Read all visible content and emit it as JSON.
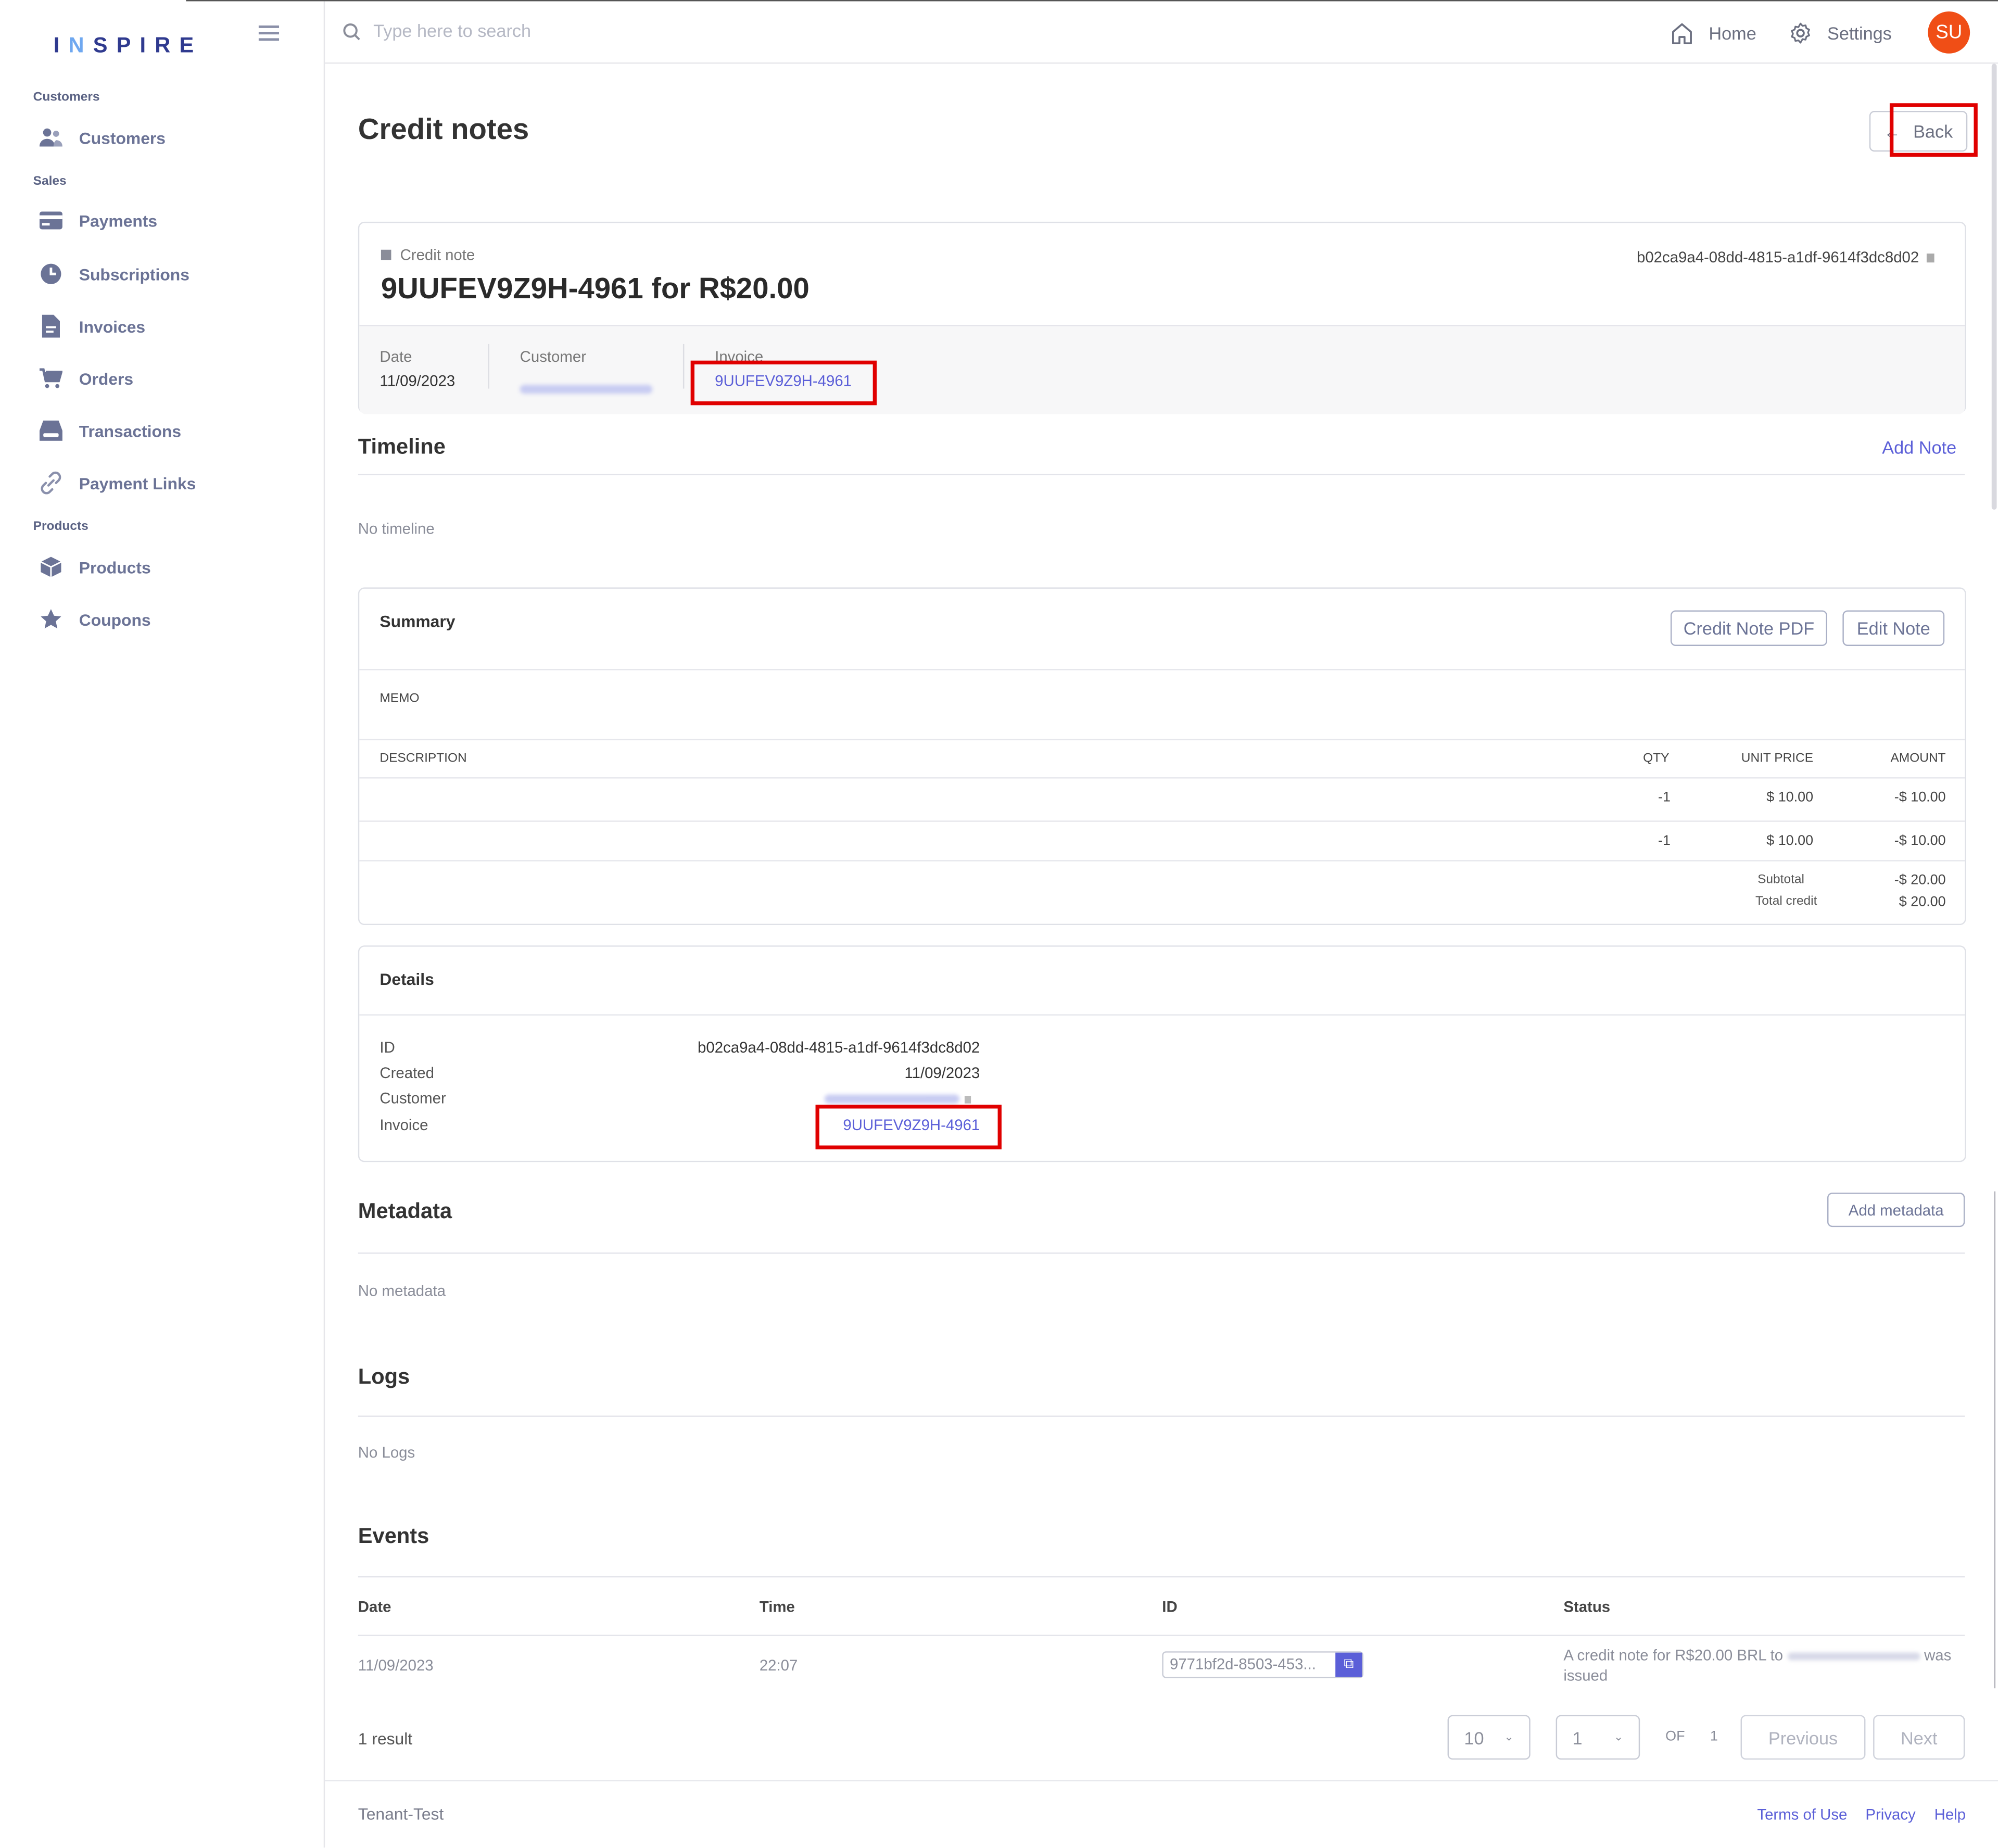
{
  "brand": {
    "logo_pre": "I",
    "logo_hl": "N",
    "logo_post": "SPIRE"
  },
  "search": {
    "placeholder": "Type here to search"
  },
  "topnav": {
    "home": "Home",
    "settings": "Settings",
    "avatar": "SU"
  },
  "sidebar": {
    "sections": {
      "customers": "Customers",
      "sales": "Sales",
      "products": "Products"
    },
    "items": {
      "customers": "Customers",
      "payments": "Payments",
      "subscriptions": "Subscriptions",
      "invoices": "Invoices",
      "orders": "Orders",
      "transactions": "Transactions",
      "payment_links": "Payment Links",
      "products": "Products",
      "coupons": "Coupons"
    }
  },
  "page": {
    "title": "Credit notes",
    "back": "Back"
  },
  "credit_note": {
    "kind": "Credit note",
    "heading": "9UUFEV9Z9H-4961 for R$20.00",
    "id": "b02ca9a4-08dd-4815-a1df-9614f3dc8d02",
    "date_label": "Date",
    "date": "11/09/2023",
    "customer_label": "Customer",
    "invoice_label": "Invoice",
    "invoice": "9UUFEV9Z9H-4961"
  },
  "timeline": {
    "title": "Timeline",
    "add_note": "Add Note",
    "empty": "No timeline"
  },
  "summary": {
    "title": "Summary",
    "pdf_button": "Credit Note PDF",
    "edit_button": "Edit Note",
    "memo": "MEMO",
    "columns": {
      "description": "DESCRIPTION",
      "qty": "QTY",
      "unit_price": "UNIT PRICE",
      "amount": "AMOUNT"
    },
    "rows": [
      {
        "qty": "-1",
        "unit_price": "$ 10.00",
        "amount": "-$ 10.00"
      },
      {
        "qty": "-1",
        "unit_price": "$ 10.00",
        "amount": "-$ 10.00"
      }
    ],
    "subtotal_label": "Subtotal",
    "subtotal": "-$ 20.00",
    "total_label": "Total credit",
    "total": "$ 20.00"
  },
  "details": {
    "title": "Details",
    "id_label": "ID",
    "id": "b02ca9a4-08dd-4815-a1df-9614f3dc8d02",
    "created_label": "Created",
    "created": "11/09/2023",
    "customer_label": "Customer",
    "invoice_label": "Invoice",
    "invoice": "9UUFEV9Z9H-4961"
  },
  "metadata": {
    "title": "Metadata",
    "add": "Add metadata",
    "empty": "No metadata"
  },
  "logs": {
    "title": "Logs",
    "empty": "No Logs"
  },
  "events": {
    "title": "Events",
    "columns": {
      "date": "Date",
      "time": "Time",
      "id": "ID",
      "status": "Status"
    },
    "rows": [
      {
        "date": "11/09/2023",
        "time": "22:07",
        "id": "9771bf2d-8503-453...",
        "status_pre": "A credit note for R$20.00 BRL to",
        "status_post": "was",
        "status_line2": "issued"
      }
    ],
    "result_count": "1 result",
    "page_size": "10",
    "page": "1",
    "of_label": "OF",
    "total_pages": "1",
    "previous": "Previous",
    "next": "Next"
  },
  "footer": {
    "tenant": "Tenant-Test",
    "terms": "Terms of Use",
    "privacy": "Privacy",
    "help": "Help"
  },
  "colors": {
    "accent": "#5b5fd8",
    "avatar": "#f04e16",
    "highlight": "#e00000",
    "sidebar_icon": "#6b7396"
  }
}
